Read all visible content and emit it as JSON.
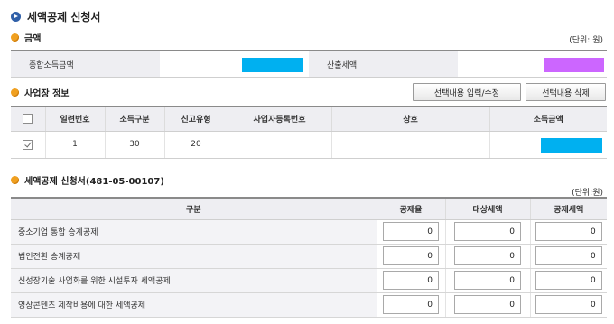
{
  "page": {
    "title": "세액공제 신청서"
  },
  "amount_section": {
    "title": "금액",
    "unit": "(단위: 원)",
    "total_income_label": "종합소득금액",
    "computed_tax_label": "산출세액",
    "colors": {
      "total_income_bar": "#00b0f0",
      "computed_tax_bar": "#cc66ff"
    }
  },
  "business_section": {
    "title": "사업장 정보",
    "buttons": {
      "input_edit": "선택내용 입력/수정",
      "delete": "선택내용 삭제"
    },
    "columns": [
      "일련번호",
      "소득구분",
      "신고유형",
      "사업자등록번호",
      "상호",
      "소득금액"
    ],
    "rows": [
      {
        "checked": true,
        "serial": "1",
        "income_type": "30",
        "report_type": "20",
        "biz_reg_no": "",
        "trade_name": ""
      }
    ],
    "colors": {
      "income_bar": "#00b0f0"
    }
  },
  "deduction_section": {
    "title": "세액공제 신청서(481-05-00107)",
    "unit": "(단위:원)",
    "columns": [
      "구분",
      "공제율",
      "대상세액",
      "공제세액"
    ],
    "rows": [
      {
        "label": "중소기업 통합 승계공제",
        "rate": "0",
        "target": "0",
        "deduction": "0"
      },
      {
        "label": "법인전환 승계공제",
        "rate": "0",
        "target": "0",
        "deduction": "0"
      },
      {
        "label": "신성장기술 사업화를 위한 시설투자 세액공제",
        "rate": "0",
        "target": "0",
        "deduction": "0"
      },
      {
        "label": "영상콘텐츠 제작비용에 대한 세액공제",
        "rate": "0",
        "target": "0",
        "deduction": "0"
      }
    ]
  }
}
